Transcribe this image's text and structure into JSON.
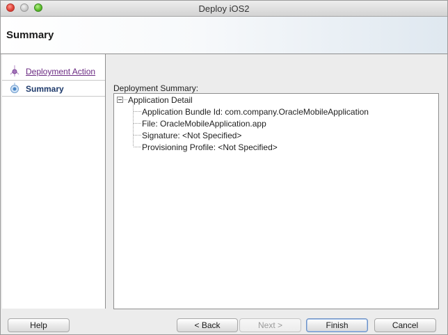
{
  "window": {
    "title": "Deploy iOS2"
  },
  "header": {
    "title": "Summary"
  },
  "sidebar": {
    "steps": [
      {
        "label": "Deployment Action",
        "state": "visited"
      },
      {
        "label": "Summary",
        "state": "current"
      }
    ]
  },
  "content": {
    "label": "Deployment Summary:",
    "tree": {
      "root": "Application Detail",
      "items": [
        "Application Bundle Id:  com.company.OracleMobileApplication",
        "File:  OracleMobileApplication.app",
        "Signature:  <Not Specified>",
        "Provisioning Profile:  <Not Specified>"
      ]
    }
  },
  "buttons": {
    "help": "Help",
    "back": "< Back",
    "next": "Next >",
    "finish": "Finish",
    "cancel": "Cancel"
  },
  "colors": {
    "link": "#6a2a82",
    "current_step": "#1e3a6b",
    "close": "#e2463b",
    "minimize": "#c9c9c9",
    "maximize": "#5fbf2e"
  },
  "icons": [
    "close-window-icon",
    "minimize-window-icon",
    "maximize-window-icon",
    "step-visited-icon",
    "step-current-icon",
    "collapse-icon"
  ]
}
